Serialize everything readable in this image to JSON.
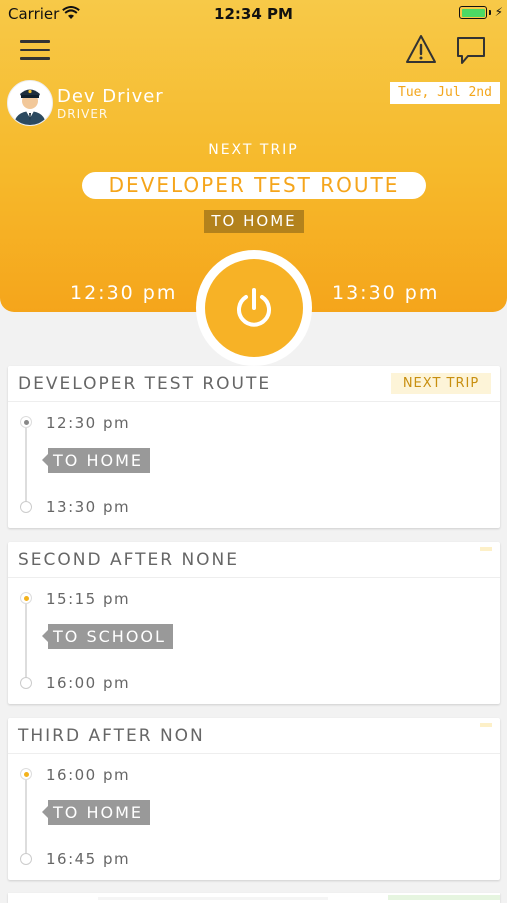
{
  "status_bar": {
    "carrier": "Carrier",
    "time": "12:34 PM"
  },
  "driver": {
    "name": "Dev Driver",
    "role": "DRIVER"
  },
  "date": "Tue, Jul 2nd",
  "next_trip": {
    "label": "NEXT TRIP",
    "route": "DEVELOPER TEST ROUTE",
    "direction": "TO HOME",
    "start_time": "12:30 pm",
    "end_time": "13:30 pm"
  },
  "trips": [
    {
      "title": "DEVELOPER TEST ROUTE",
      "tag": "NEXT TRIP",
      "start": "12:30 pm",
      "direction": "TO HOME",
      "end": "13:30 pm"
    },
    {
      "title": "SECOND AFTER NONE",
      "start": "15:15 pm",
      "direction": "TO SCHOOL",
      "end": "16:00 pm"
    },
    {
      "title": "THIRD AFTER NON",
      "start": "16:00 pm",
      "direction": "TO HOME",
      "end": "16:45 pm"
    }
  ],
  "colors": {
    "accent": "#f5a51b",
    "header_top": "#f7c948",
    "next_dot": "#888888",
    "upcoming_dot": "#f3b21c",
    "tag_grey": "#999999"
  },
  "icons": {
    "menu": "hamburger-menu-icon",
    "alert": "warning-triangle-icon",
    "chat": "chat-bubble-icon",
    "power": "power-icon"
  }
}
